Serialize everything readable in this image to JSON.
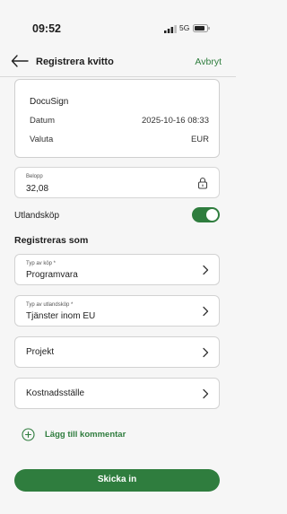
{
  "status_bar": {
    "time": "09:52",
    "network": "5G"
  },
  "header": {
    "title": "Registrera kvitto",
    "cancel_label": "Avbryt",
    "back_icon": "arrow-left-icon"
  },
  "receipt": {
    "merchant": "DocuSign",
    "rows": [
      {
        "label": "Datum",
        "value": "2025-10-16 08:33"
      },
      {
        "label": "Valuta",
        "value": "EUR"
      }
    ]
  },
  "amount": {
    "label": "Belopp",
    "value": "32,08",
    "icon": "lock-icon"
  },
  "foreign_purchase": {
    "label": "Utlandsköp",
    "enabled": true
  },
  "register_as": {
    "heading": "Registreras som",
    "fields": [
      {
        "label": "Typ av köp *",
        "value": "Programvara"
      },
      {
        "label": "Typ av utlandsköp *",
        "value": "Tjänster inom EU"
      },
      {
        "label": "",
        "value": "Projekt"
      },
      {
        "label": "",
        "value": "Kostnadsställe"
      }
    ]
  },
  "add_comment": {
    "label": "Lägg till kommentar",
    "icon": "plus-circle-icon"
  },
  "submit": {
    "label": "Skicka in"
  },
  "colors": {
    "accent": "#2f7d3e",
    "background": "#f6f6f6"
  }
}
